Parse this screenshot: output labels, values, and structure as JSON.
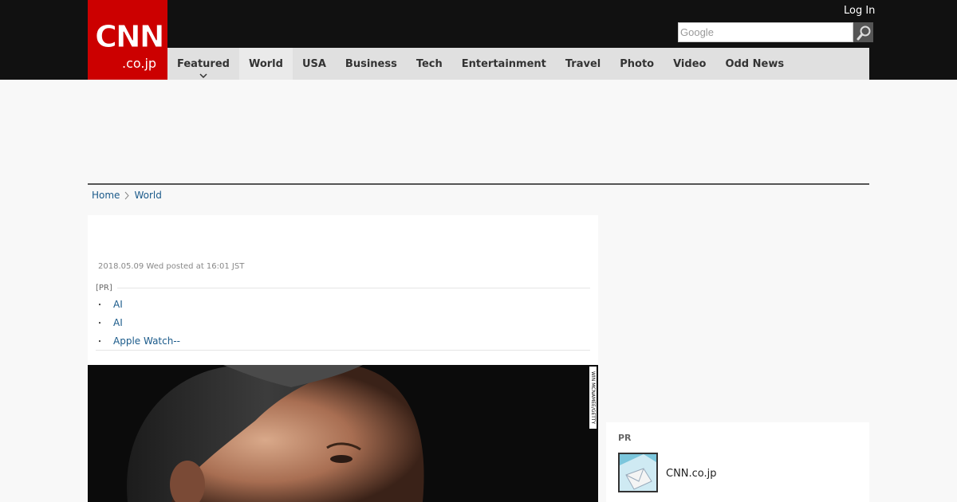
{
  "header": {
    "logo_main": "CNN",
    "logo_sub": ".co.jp",
    "login_label": "Log In",
    "search_placeholder": "Google"
  },
  "nav": {
    "items": [
      {
        "label": "Featured"
      },
      {
        "label": "World"
      },
      {
        "label": "USA"
      },
      {
        "label": "Business"
      },
      {
        "label": "Tech"
      },
      {
        "label": "Entertainment"
      },
      {
        "label": "Travel"
      },
      {
        "label": "Photo"
      },
      {
        "label": "Video"
      },
      {
        "label": "Odd News"
      }
    ],
    "active": "World"
  },
  "breadcrumb": {
    "home": "Home",
    "current": "World"
  },
  "article": {
    "dateline": "2018.05.09 Wed posted at 16:01 JST",
    "pr_label": "[PR]",
    "pr_links": [
      "AI",
      "AI",
      "Apple Watch--"
    ],
    "photo_credit": "WIN MCNAMEE/GETTY"
  },
  "sidebar": {
    "pr_label": "PR",
    "pr_item_title": "CNN.co.jp"
  },
  "colors": {
    "brand_red": "#cc0000",
    "topbar": "#111111",
    "nav_bg": "#e0e0e0",
    "link": "#1a5a8a"
  }
}
